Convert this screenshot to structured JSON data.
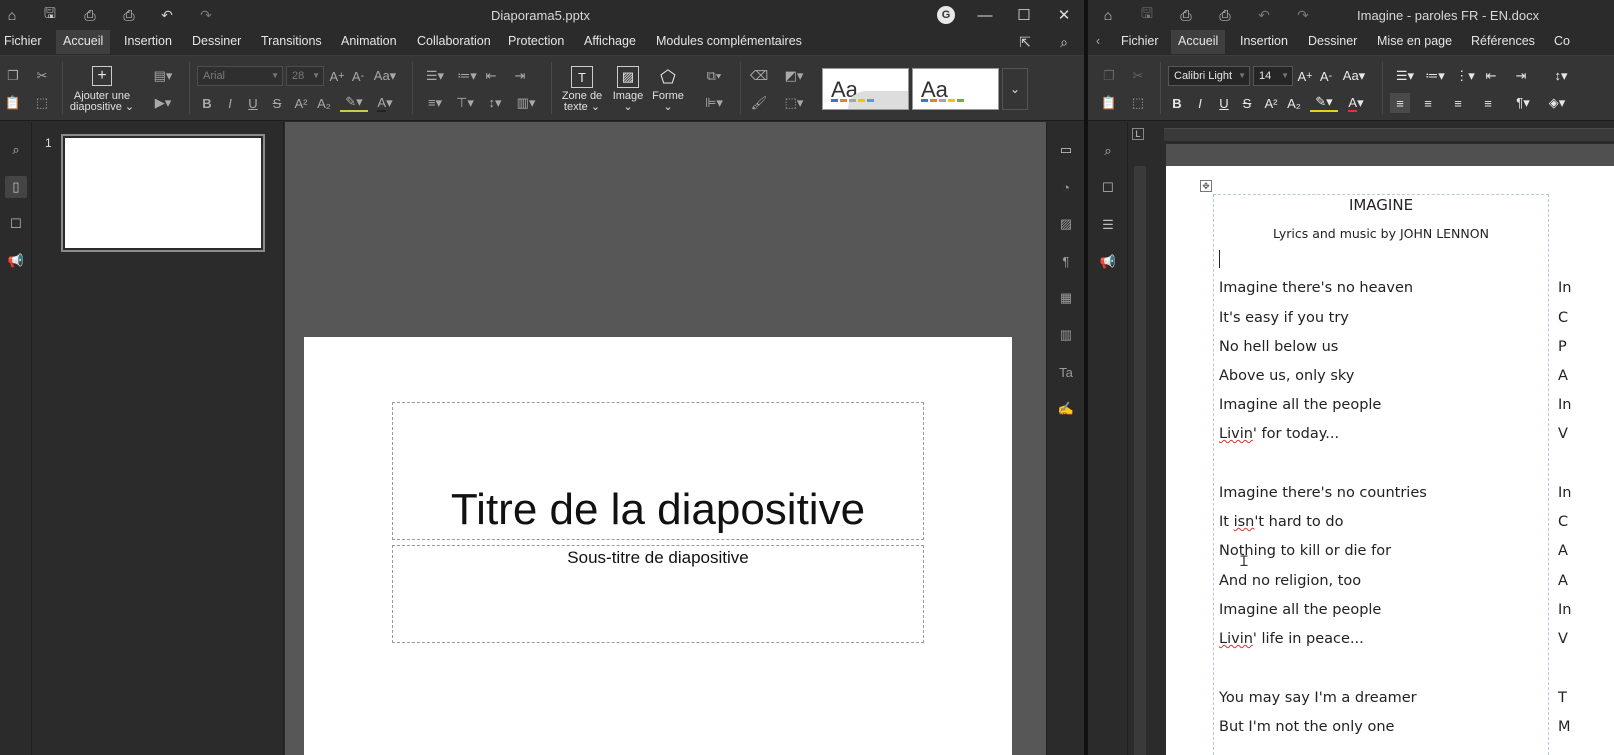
{
  "left_window": {
    "title": "Diaporama5.pptx",
    "avatar_letter": "G",
    "menus": [
      "Fichier",
      "Accueil",
      "Insertion",
      "Dessiner",
      "Transitions",
      "Animation",
      "Collaboration",
      "Protection",
      "Affichage",
      "Modules complémentaires"
    ],
    "active_menu": "Accueil",
    "ribbon": {
      "font_name": "Arial",
      "font_size": "28",
      "add_slide_line1": "Ajouter une",
      "add_slide_line2": "diapositive",
      "textbox_line1": "Zone de",
      "textbox_line2": "texte",
      "image_label": "Image",
      "shape_label": "Forme",
      "theme_aa_1": "Aa",
      "theme_aa_2": "Aa"
    },
    "thumbnail_number": "1",
    "slide": {
      "title": "Titre de la diapositive",
      "subtitle": "Sous-titre de diapositive"
    }
  },
  "right_window": {
    "title": "Imagine - paroles FR - EN.docx",
    "menus": [
      "Fichier",
      "Accueil",
      "Insertion",
      "Dessiner",
      "Mise en page",
      "Références",
      "Co"
    ],
    "active_menu": "Accueil",
    "ribbon": {
      "font_name": "Calibri Light",
      "font_size": "14"
    },
    "document": {
      "heading": "IMAGINE",
      "byline": "Lyrics and music by  JOHN LENNON",
      "verse1": [
        "Imagine there's no heaven",
        "It's easy if you try",
        "No hell below us",
        "Above us, only sky",
        "Imagine all the people"
      ],
      "v1_last_a": "Livin",
      "v1_last_b": "' for today...",
      "verse2": [
        "Imagine there's no countries"
      ],
      "v2_l2_a": "It ",
      "v2_l2_b": "isn",
      "v2_l2_c": "'t hard to do",
      "verse2b": [
        "Nothing to kill or die for",
        "And no religion, too",
        "Imagine all the people"
      ],
      "v2_last_a": "Livin",
      "v2_last_b": "' life in peace...",
      "verse3": [
        "You may say I'm a dreamer",
        "But I'm not the only one"
      ],
      "second_column_initials": [
        "In",
        "C",
        "P",
        "A",
        "In",
        "V",
        "In",
        "C",
        "A",
        "A",
        "In",
        "V",
        "T",
        "M"
      ]
    }
  },
  "colors": {
    "ui_bg": "#2b2b2b",
    "ribbon_bg": "#353535",
    "canvas_bg": "#575757",
    "doc_bg": "#505050",
    "spell_underline": "#d33"
  }
}
